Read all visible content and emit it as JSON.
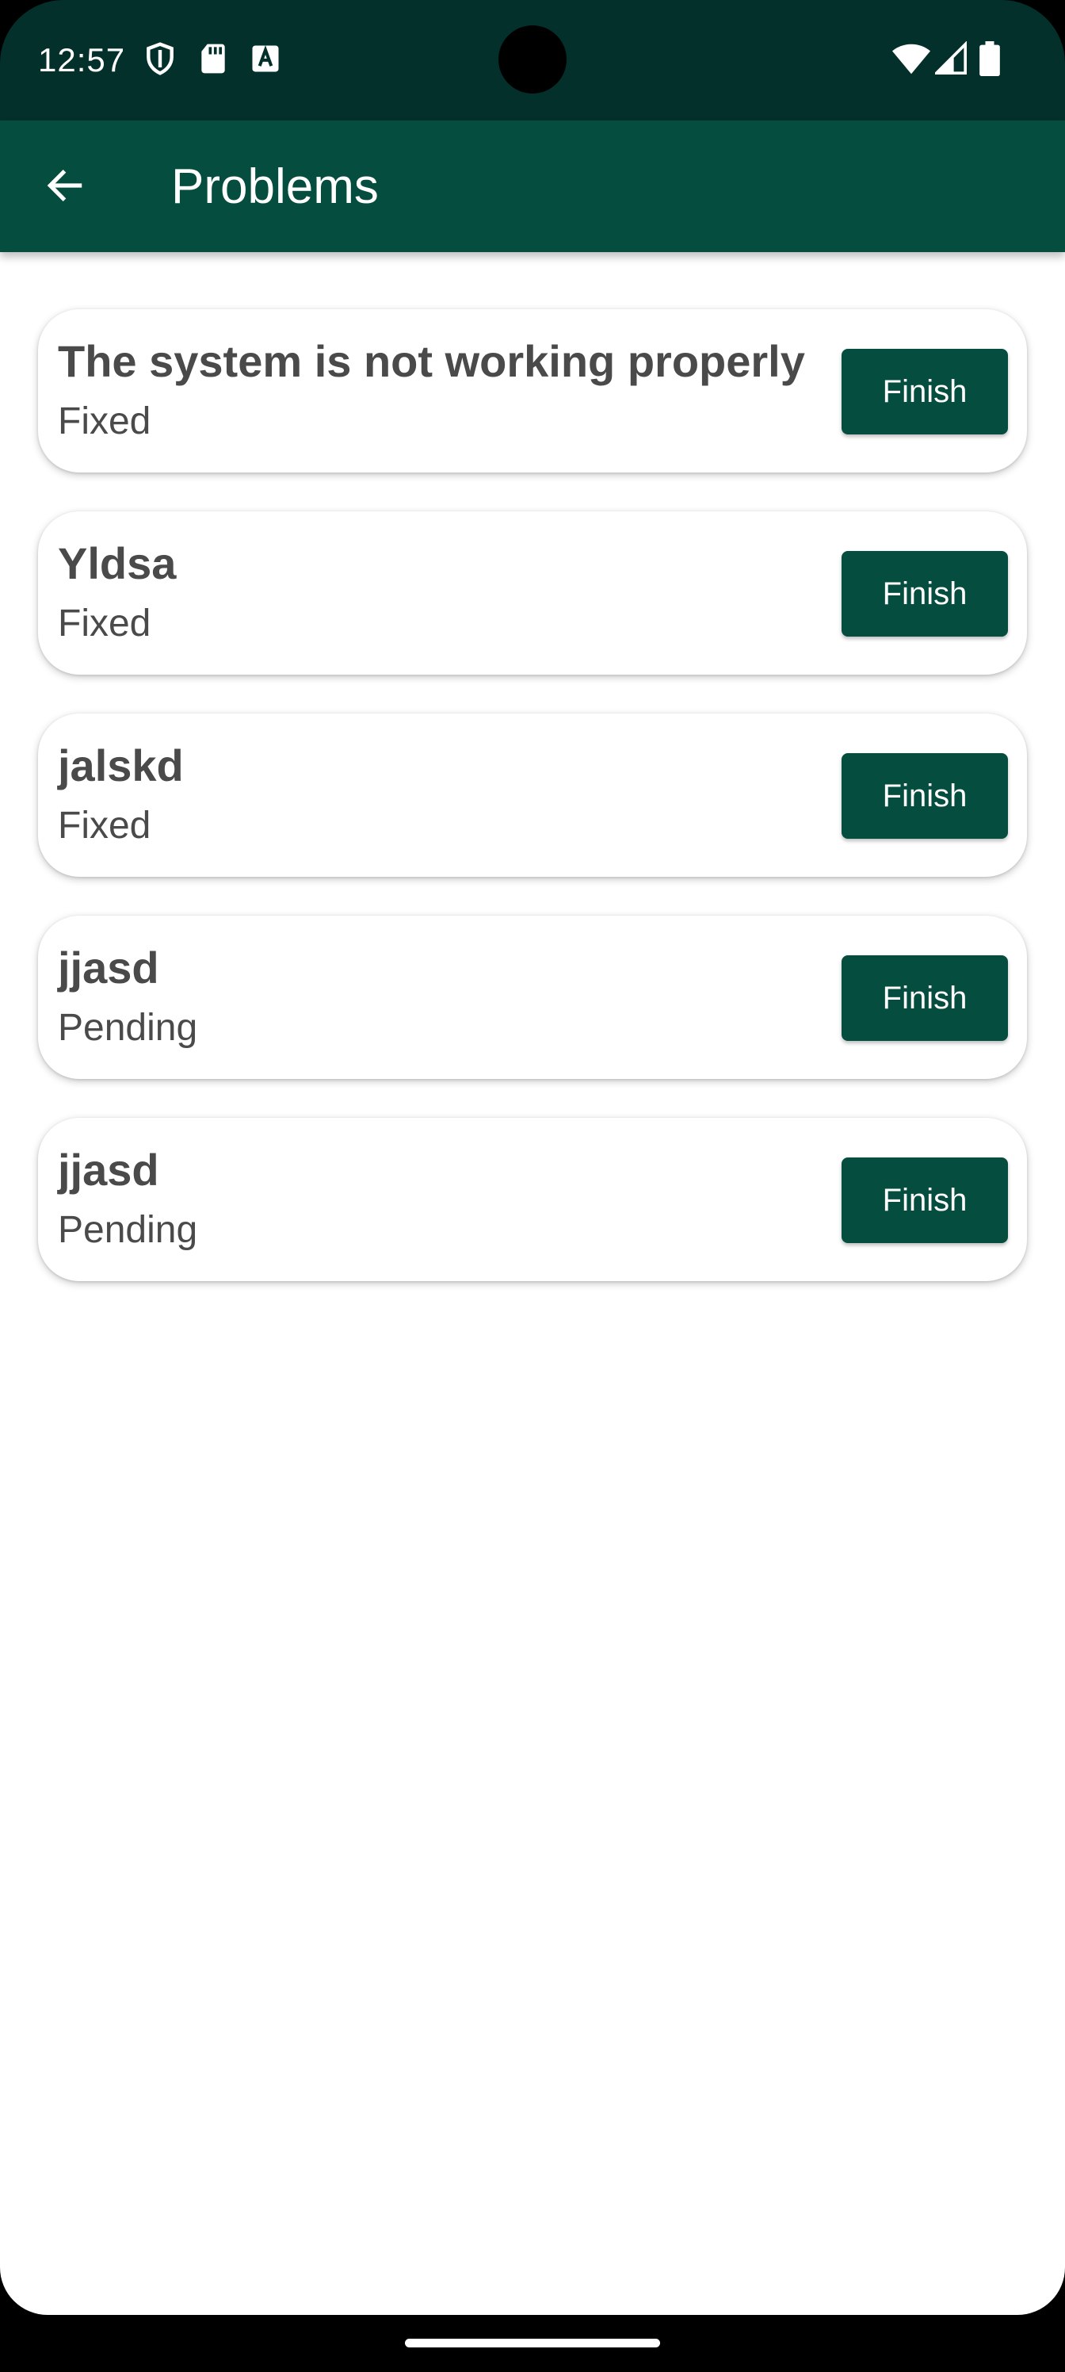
{
  "status_bar": {
    "time": "12:57",
    "icons_left": [
      "shield-icon",
      "sd-card-icon",
      "keyboard-a-icon"
    ],
    "icons_right": [
      "wifi-icon",
      "signal-icon",
      "battery-icon"
    ]
  },
  "app_bar": {
    "title": "Problems",
    "back_icon": "arrow-back-icon"
  },
  "colors": {
    "status_bar_bg": "#03302a",
    "app_bar_bg": "#054d3e",
    "button_bg": "#054d3e",
    "card_text": "#4a4a4a",
    "background": "#ffffff"
  },
  "problems": [
    {
      "title": "The system is not working properly",
      "status": "Fixed",
      "button_label": "Finish"
    },
    {
      "title": "Yldsa",
      "status": "Fixed",
      "button_label": "Finish"
    },
    {
      "title": "jalskd",
      "status": "Fixed",
      "button_label": "Finish"
    },
    {
      "title": "jjasd",
      "status": "Pending",
      "button_label": "Finish"
    },
    {
      "title": "jjasd",
      "status": "Pending",
      "button_label": "Finish"
    }
  ]
}
